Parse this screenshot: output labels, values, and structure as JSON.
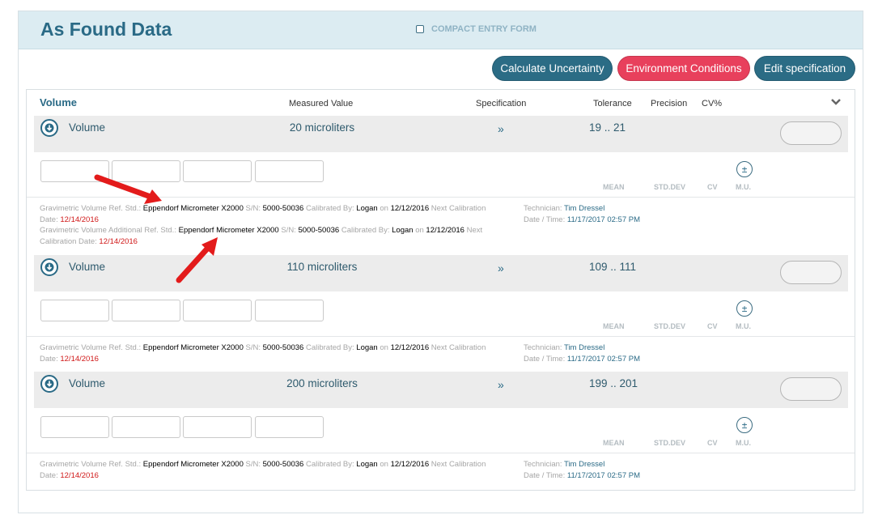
{
  "header": {
    "title": "As Found Data",
    "compact_label": "COMPACT ENTRY FORM"
  },
  "toolbar": {
    "calc_label": "Calculate Uncertainty",
    "env_label": "Environment Conditions",
    "edit_label": "Edit specification"
  },
  "table": {
    "group_label": "Volume",
    "col_measured": "Measured Value",
    "col_spec": "Specification",
    "col_tolerance": "Tolerance",
    "col_precision": "Precision",
    "col_cv": "CV%"
  },
  "stats": {
    "mean": "MEAN",
    "stddev": "STD.DEV",
    "cv": "CV",
    "mu": "M.U.",
    "pm": "±"
  },
  "rows": [
    {
      "label": "Volume",
      "measured": "20 microliters",
      "spec": "»",
      "tolerance": "19 .. 21"
    },
    {
      "label": "Volume",
      "measured": "110 microliters",
      "spec": "»",
      "tolerance": "109 .. 111"
    },
    {
      "label": "Volume",
      "measured": "200 microliters",
      "spec": "»",
      "tolerance": "199 .. 201"
    }
  ],
  "info": {
    "ref_prefix": "Gravimetric Volume Ref. Std.:",
    "add_prefix": "Gravimetric Volume Additional Ref. Std.:",
    "device": "Eppendorf Micrometer X2000",
    "sn_label": "S/N:",
    "sn": "5000-50036",
    "cal_by_label": "Calibrated By:",
    "cal_by": "Logan",
    "on_label": "on",
    "cal_date": "12/12/2016",
    "next_label": "Next Calibration",
    "date_label": "Date:",
    "next_date": "12/14/2016",
    "next_cal_a": "Next",
    "next_cal_b": "Calibration Date:",
    "tech_label": "Technician:",
    "tech": "Tim Dressel",
    "dt_label": "Date / Time:",
    "dt": "11/17/2017 02:57 PM"
  }
}
